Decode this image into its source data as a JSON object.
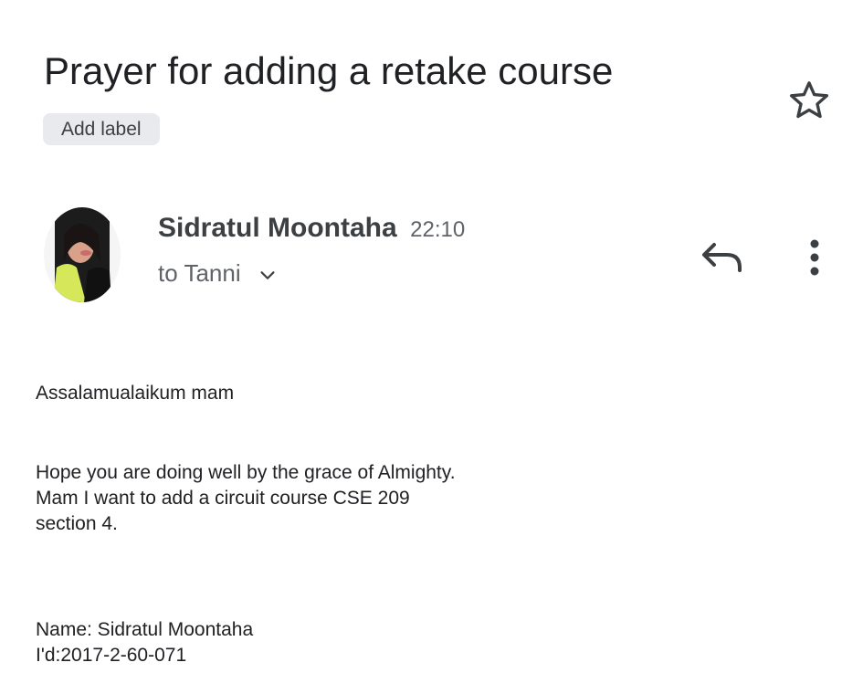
{
  "email": {
    "subject": "Prayer for adding a retake course",
    "add_label": "Add label",
    "star_icon": "star-outline-icon",
    "sender": {
      "name": "Sidratul Moontaha",
      "time": "22:10",
      "recipient": "to Tanni",
      "avatar": "profile-photo"
    },
    "actions": {
      "reply_icon": "reply-icon",
      "more_icon": "more-vert-icon",
      "expand_icon": "chevron-down-icon"
    },
    "body": {
      "greeting": "Assalamualaikum mam",
      "paragraph": [
        "Hope you are doing well by the grace of Almighty.",
        "Mam I want to add a circuit course CSE 209",
        "section 4."
      ],
      "signature": [
        "Name: Sidratul Moontaha",
        "I'd:2017-2-60-071"
      ]
    }
  }
}
